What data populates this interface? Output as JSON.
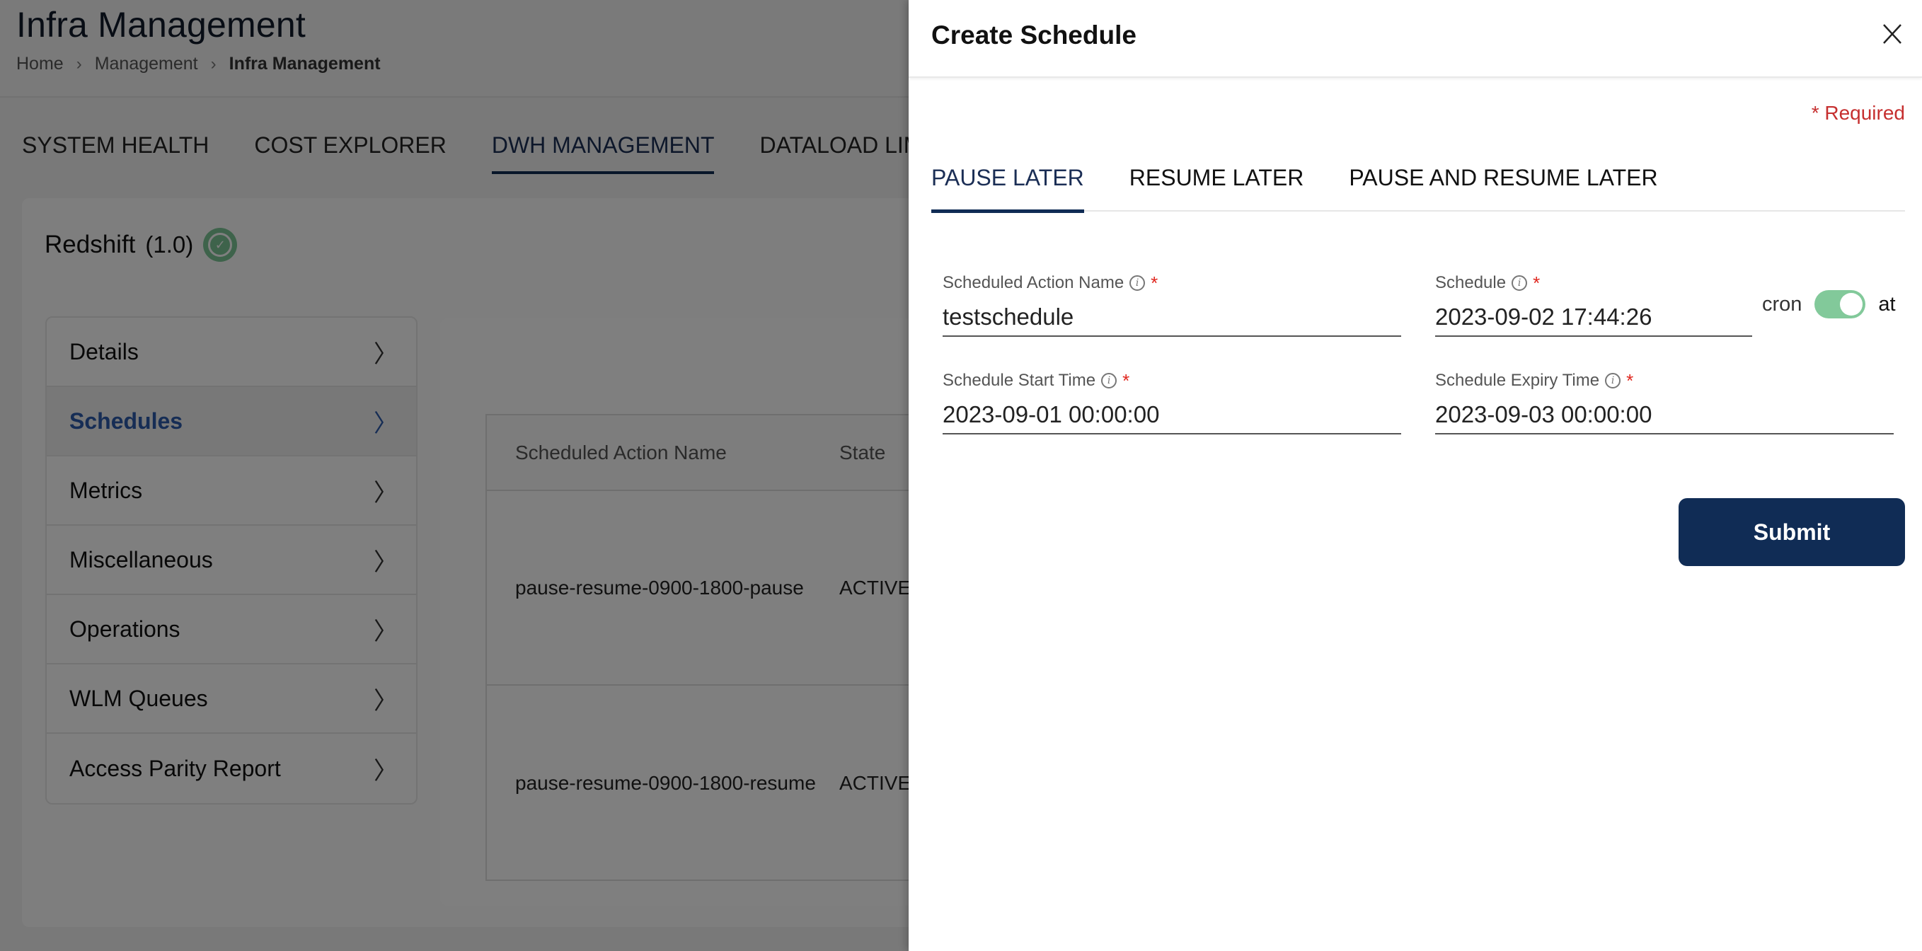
{
  "page": {
    "title": "Infra Management",
    "breadcrumb": [
      "Home",
      "Management",
      "Infra Management"
    ],
    "tabs": [
      {
        "label": "SYSTEM HEALTH",
        "active": false
      },
      {
        "label": "COST EXPLORER",
        "active": false
      },
      {
        "label": "DWH MANAGEMENT",
        "active": true
      },
      {
        "label": "DATALOAD LIMITS",
        "active": false
      }
    ],
    "cluster": {
      "name": "Redshift",
      "version": "(1.0)",
      "status_icon": "check-circle-icon",
      "status_color": "#7dc697"
    },
    "sidebar": {
      "items": [
        {
          "label": "Details",
          "active": false
        },
        {
          "label": "Schedules",
          "active": true
        },
        {
          "label": "Metrics",
          "active": false
        },
        {
          "label": "Miscellaneous",
          "active": false
        },
        {
          "label": "Operations",
          "active": false
        },
        {
          "label": "WLM Queues",
          "active": false
        },
        {
          "label": "Access Parity Report",
          "active": false
        }
      ]
    },
    "table": {
      "columns": [
        "Scheduled Action Name",
        "State"
      ],
      "rows": [
        {
          "name": "pause-resume-0900-1800-pause",
          "state": "ACTIVE"
        },
        {
          "name": "pause-resume-0900-1800-resume",
          "state": "ACTIVE"
        }
      ]
    }
  },
  "drawer": {
    "title": "Create Schedule",
    "close_icon": "close-icon",
    "required_note": "* Required",
    "tabs": [
      {
        "label": "PAUSE LATER",
        "active": true
      },
      {
        "label": "RESUME LATER",
        "active": false
      },
      {
        "label": "PAUSE AND RESUME LATER",
        "active": false
      }
    ],
    "fields": {
      "action_name": {
        "label": "Scheduled Action Name",
        "value": "testschedule",
        "required": "*"
      },
      "schedule": {
        "label": "Schedule",
        "value": "2023-09-02 17:44:26",
        "required": "*"
      },
      "start_time": {
        "label": "Schedule Start Time",
        "value": "2023-09-01 00:00:00",
        "required": "*"
      },
      "expiry_time": {
        "label": "Schedule Expiry Time",
        "value": "2023-09-03 00:00:00",
        "required": "*"
      }
    },
    "schedule_type_toggle": {
      "off_label": "cron",
      "on_label": "at",
      "checked": true,
      "color": "#82c99a"
    },
    "submit_label": "Submit",
    "colors": {
      "primary": "#102c55",
      "required": "#c62f2f"
    }
  }
}
